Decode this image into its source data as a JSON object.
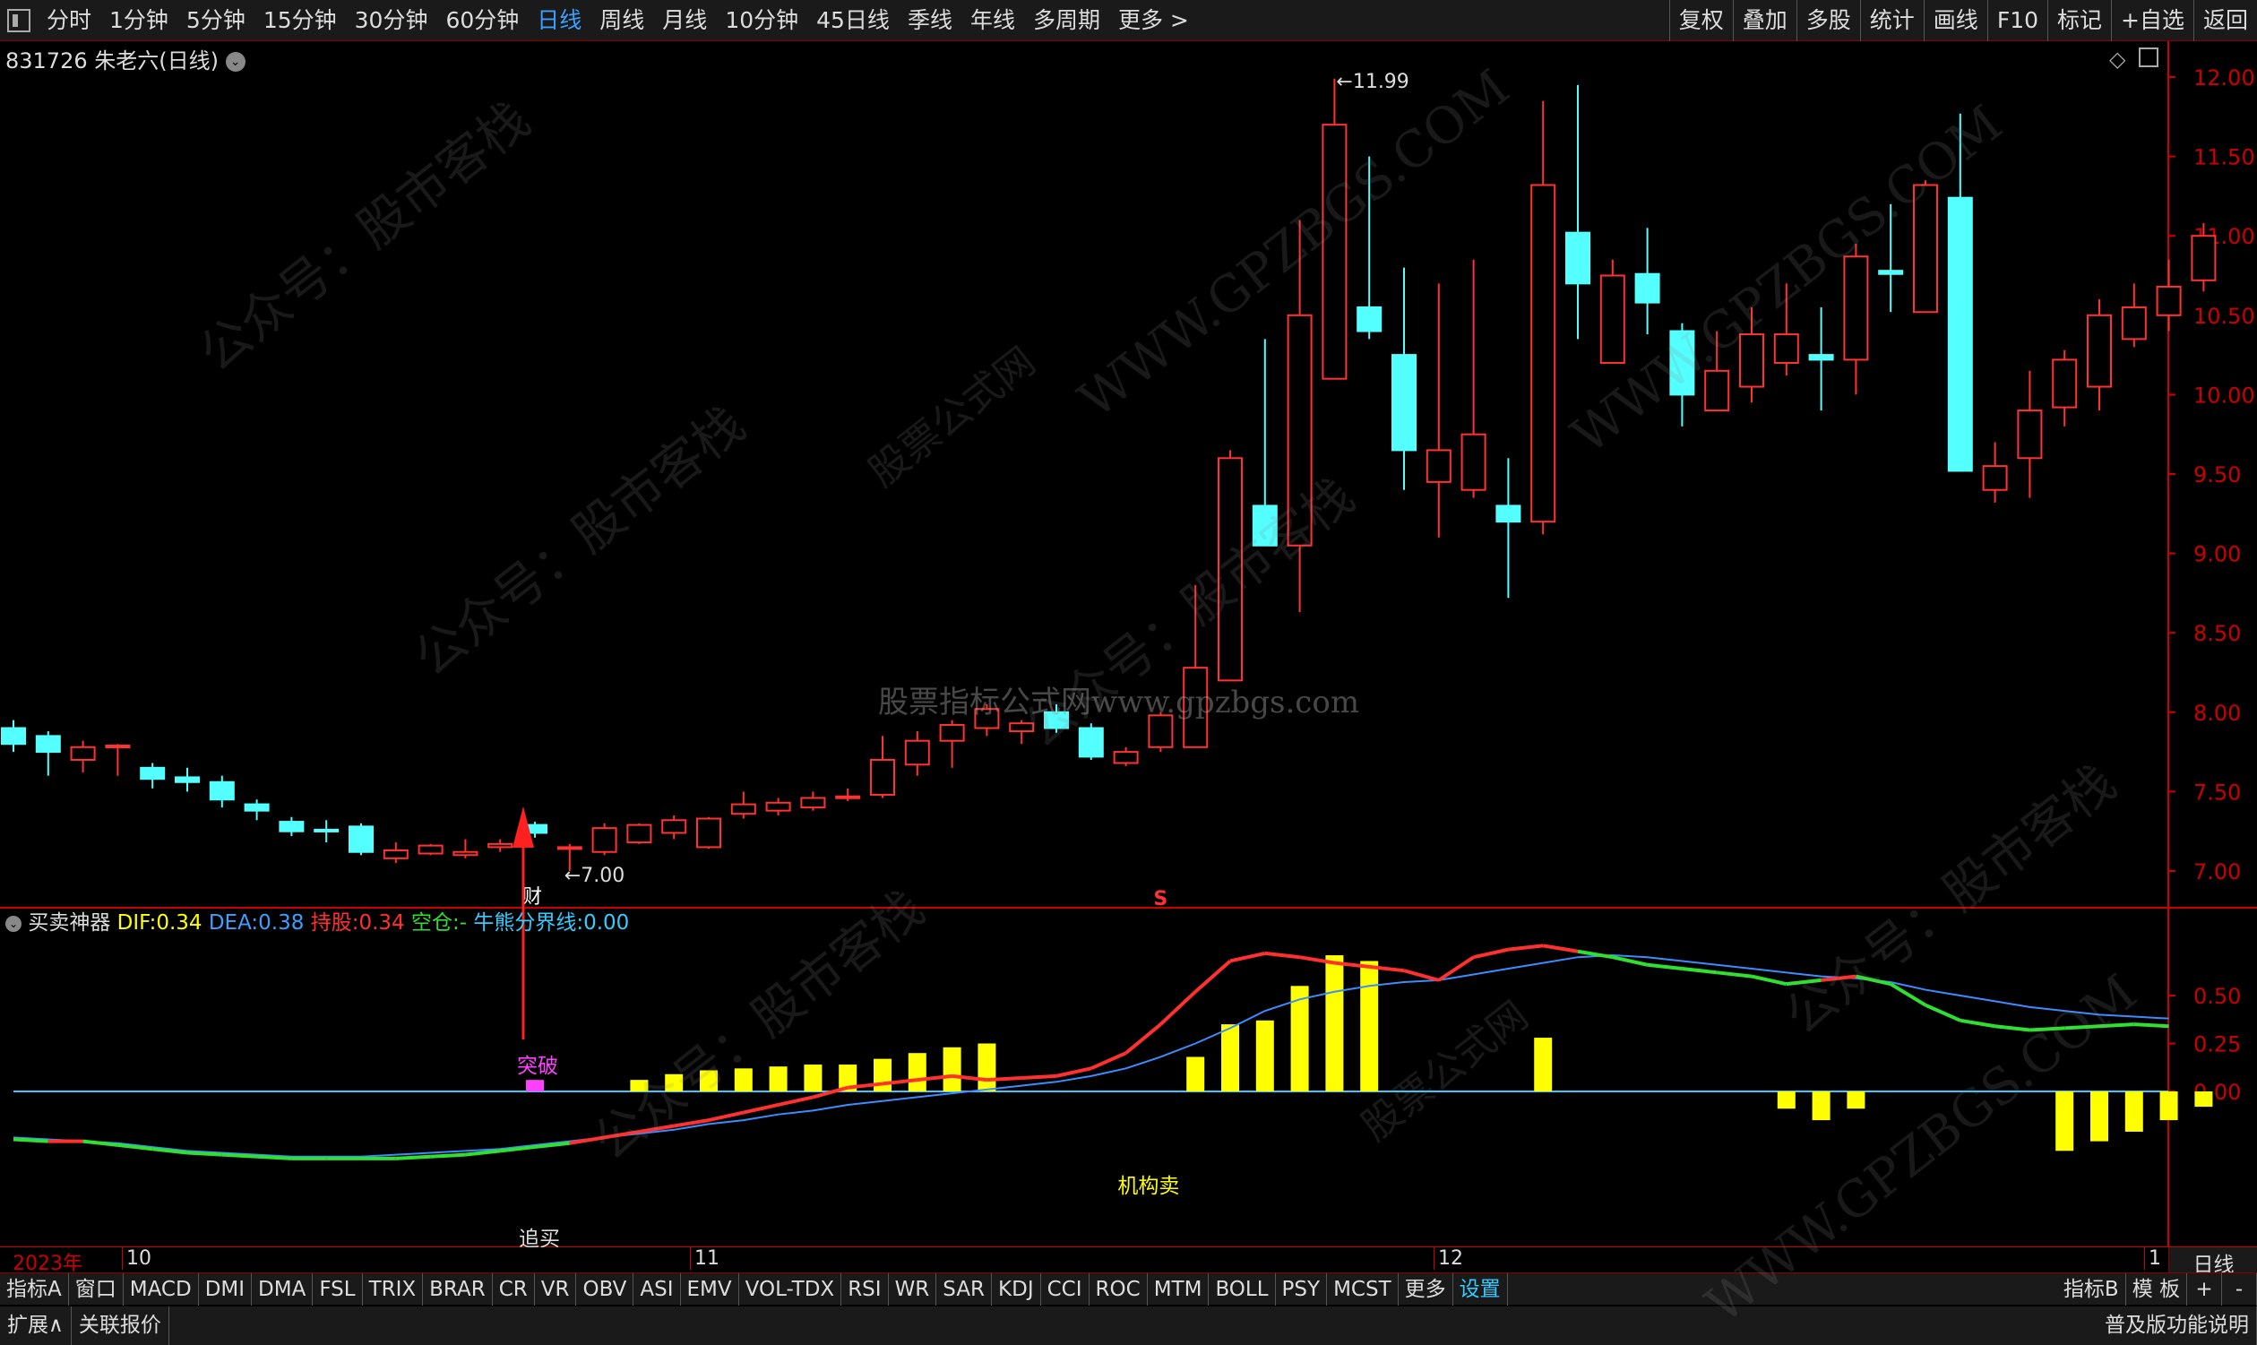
{
  "toolbar": {
    "periods": [
      "分时",
      "1分钟",
      "5分钟",
      "15分钟",
      "30分钟",
      "60分钟",
      "日线",
      "周线",
      "月线",
      "10分钟",
      "45日线",
      "季线",
      "年线",
      "多周期",
      "更多 >"
    ],
    "active": "日线",
    "right": [
      "复权",
      "叠加",
      "多股",
      "统计",
      "画线",
      "F10",
      "标记",
      "+自选",
      "返回"
    ]
  },
  "title": {
    "code_name": "831726 朱老六(日线)",
    "info_icon": "chevron-down"
  },
  "price_axis": [
    "12.00",
    "11.50",
    "11.00",
    "10.50",
    "10.00",
    "9.50",
    "9.00",
    "8.50",
    "8.00",
    "7.50",
    "7.00"
  ],
  "annotations": {
    "high": "11.99",
    "low": "7.00",
    "cai": "财",
    "s_marker": "S",
    "tupo": "突破",
    "jigoumai": "机构卖",
    "zhuimai": "追买"
  },
  "indicator": {
    "name": "买卖神器",
    "dif_label": "DIF:",
    "dif": "0.34",
    "dea_label": "DEA:",
    "dea": "0.38",
    "hold_label": "持股:",
    "hold": "0.34",
    "empty_label": "空仓:",
    "empty": "-",
    "bull_label": "牛熊分界线:",
    "bull": "0.00",
    "axis": [
      "0.50",
      "0.25",
      "0.00"
    ]
  },
  "dates": [
    "2023年",
    "10",
    "11",
    "12",
    "1"
  ],
  "date_right": "日线",
  "indicators": [
    "指标A",
    "窗口",
    "MACD",
    "DMI",
    "DMA",
    "FSL",
    "TRIX",
    "BRAR",
    "CR",
    "VR",
    "OBV",
    "ASI",
    "EMV",
    "VOL-TDX",
    "RSI",
    "WR",
    "SAR",
    "KDJ",
    "CCI",
    "ROC",
    "MTM",
    "BOLL",
    "PSY",
    "MCST",
    "更多",
    "设置"
  ],
  "indicators_right": [
    "指标B",
    "模 板",
    "+",
    "-"
  ],
  "bottom": [
    "扩展∧",
    "关联报价"
  ],
  "bottom_right": "普及版功能说明",
  "watermarks": [
    "公众号：股市客栈",
    "WWW.GPZBGS.COM",
    "股票公式网",
    "股票指标公式网www.gpzbgs.com"
  ],
  "chart_data": {
    "type": "candlestick",
    "ylim": [
      6.9,
      12.1
    ],
    "candles": [
      {
        "o": 7.9,
        "c": 7.8,
        "h": 7.95,
        "l": 7.75
      },
      {
        "o": 7.85,
        "c": 7.75,
        "h": 7.88,
        "l": 7.6
      },
      {
        "o": 7.7,
        "c": 7.78,
        "h": 7.82,
        "l": 7.62
      },
      {
        "o": 7.78,
        "c": 7.79,
        "h": 7.8,
        "l": 7.6
      },
      {
        "o": 7.65,
        "c": 7.58,
        "h": 7.68,
        "l": 7.52
      },
      {
        "o": 7.59,
        "c": 7.56,
        "h": 7.65,
        "l": 7.5
      },
      {
        "o": 7.56,
        "c": 7.45,
        "h": 7.6,
        "l": 7.4
      },
      {
        "o": 7.42,
        "c": 7.38,
        "h": 7.45,
        "l": 7.32
      },
      {
        "o": 7.31,
        "c": 7.25,
        "h": 7.34,
        "l": 7.22
      },
      {
        "o": 7.26,
        "c": 7.25,
        "h": 7.32,
        "l": 7.18
      },
      {
        "o": 7.28,
        "c": 7.12,
        "h": 7.3,
        "l": 7.1
      },
      {
        "o": 7.08,
        "c": 7.13,
        "h": 7.18,
        "l": 7.05
      },
      {
        "o": 7.11,
        "c": 7.16,
        "h": 7.17,
        "l": 7.1
      },
      {
        "o": 7.1,
        "c": 7.12,
        "h": 7.2,
        "l": 7.08
      },
      {
        "o": 7.15,
        "c": 7.17,
        "h": 7.2,
        "l": 7.12
      },
      {
        "o": 7.29,
        "c": 7.24,
        "h": 7.31,
        "l": 7.21
      },
      {
        "o": 7.14,
        "c": 7.15,
        "h": 7.17,
        "l": 7.0
      },
      {
        "o": 7.12,
        "c": 7.27,
        "h": 7.3,
        "l": 7.1
      },
      {
        "o": 7.18,
        "c": 7.29,
        "h": 7.3,
        "l": 7.17
      },
      {
        "o": 7.24,
        "c": 7.32,
        "h": 7.35,
        "l": 7.2
      },
      {
        "o": 7.15,
        "c": 7.33,
        "h": 7.34,
        "l": 7.14
      },
      {
        "o": 7.36,
        "c": 7.42,
        "h": 7.5,
        "l": 7.33
      },
      {
        "o": 7.38,
        "c": 7.43,
        "h": 7.46,
        "l": 7.35
      },
      {
        "o": 7.4,
        "c": 7.46,
        "h": 7.5,
        "l": 7.38
      },
      {
        "o": 7.46,
        "c": 7.47,
        "h": 7.52,
        "l": 7.44
      },
      {
        "o": 7.48,
        "c": 7.7,
        "h": 7.85,
        "l": 7.46
      },
      {
        "o": 7.67,
        "c": 7.82,
        "h": 7.88,
        "l": 7.6
      },
      {
        "o": 7.82,
        "c": 7.92,
        "h": 7.95,
        "l": 7.65
      },
      {
        "o": 7.9,
        "c": 8.02,
        "h": 8.05,
        "l": 7.85
      },
      {
        "o": 7.88,
        "c": 7.93,
        "h": 7.95,
        "l": 7.8
      },
      {
        "o": 8.0,
        "c": 7.9,
        "h": 8.05,
        "l": 7.87
      },
      {
        "o": 7.9,
        "c": 7.72,
        "h": 7.93,
        "l": 7.7
      },
      {
        "o": 7.68,
        "c": 7.75,
        "h": 7.78,
        "l": 7.66
      },
      {
        "o": 7.78,
        "c": 7.98,
        "h": 8.0,
        "l": 7.75
      },
      {
        "o": 7.78,
        "c": 8.28,
        "h": 8.8,
        "l": 7.78
      },
      {
        "o": 8.2,
        "c": 9.6,
        "h": 9.65,
        "l": 8.2
      },
      {
        "o": 9.3,
        "c": 9.05,
        "h": 10.35,
        "l": 9.05
      },
      {
        "o": 9.05,
        "c": 10.5,
        "h": 11.1,
        "l": 8.63
      },
      {
        "o": 10.1,
        "c": 11.7,
        "h": 11.99,
        "l": 10.1
      },
      {
        "o": 10.55,
        "c": 10.4,
        "h": 11.5,
        "l": 10.35
      },
      {
        "o": 10.25,
        "c": 9.65,
        "h": 10.8,
        "l": 9.4
      },
      {
        "o": 9.45,
        "c": 9.65,
        "h": 10.7,
        "l": 9.1
      },
      {
        "o": 9.4,
        "c": 9.75,
        "h": 10.85,
        "l": 9.35
      },
      {
        "o": 9.3,
        "c": 9.2,
        "h": 9.6,
        "l": 8.72
      },
      {
        "o": 9.2,
        "c": 11.32,
        "h": 11.85,
        "l": 9.12
      },
      {
        "o": 11.02,
        "c": 10.7,
        "h": 11.95,
        "l": 10.35
      },
      {
        "o": 10.2,
        "c": 10.75,
        "h": 10.85,
        "l": 10.2
      },
      {
        "o": 10.76,
        "c": 10.58,
        "h": 11.05,
        "l": 10.38
      },
      {
        "o": 10.4,
        "c": 10.0,
        "h": 10.45,
        "l": 9.8
      },
      {
        "o": 9.9,
        "c": 10.15,
        "h": 10.4,
        "l": 9.9
      },
      {
        "o": 10.05,
        "c": 10.38,
        "h": 10.55,
        "l": 9.95
      },
      {
        "o": 10.2,
        "c": 10.38,
        "h": 10.7,
        "l": 10.12
      },
      {
        "o": 10.25,
        "c": 10.22,
        "h": 10.55,
        "l": 9.9
      },
      {
        "o": 10.22,
        "c": 10.87,
        "h": 10.95,
        "l": 10.0
      },
      {
        "o": 10.78,
        "c": 10.76,
        "h": 11.2,
        "l": 10.52
      },
      {
        "o": 10.52,
        "c": 11.32,
        "h": 11.35,
        "l": 10.52
      },
      {
        "o": 11.24,
        "c": 9.52,
        "h": 11.77,
        "l": 9.52
      },
      {
        "o": 9.4,
        "c": 9.55,
        "h": 9.7,
        "l": 9.32
      },
      {
        "o": 9.6,
        "c": 9.9,
        "h": 10.15,
        "l": 9.35
      },
      {
        "o": 9.92,
        "c": 10.22,
        "h": 10.28,
        "l": 9.8
      },
      {
        "o": 10.05,
        "c": 10.5,
        "h": 10.6,
        "l": 9.9
      },
      {
        "o": 10.35,
        "c": 10.55,
        "h": 10.7,
        "l": 10.3
      },
      {
        "o": 10.5,
        "c": 10.68,
        "h": 10.85,
        "l": 10.4
      },
      {
        "o": 10.72,
        "c": 11.0,
        "h": 11.08,
        "l": 10.65
      }
    ],
    "indicator_bars": [
      {
        "i": 15,
        "v": 0.06,
        "color": "#ff40ff"
      },
      {
        "i": 18,
        "v": 0.06
      },
      {
        "i": 19,
        "v": 0.09
      },
      {
        "i": 20,
        "v": 0.11
      },
      {
        "i": 21,
        "v": 0.12
      },
      {
        "i": 22,
        "v": 0.13
      },
      {
        "i": 23,
        "v": 0.14
      },
      {
        "i": 24,
        "v": 0.14
      },
      {
        "i": 25,
        "v": 0.17
      },
      {
        "i": 26,
        "v": 0.2
      },
      {
        "i": 27,
        "v": 0.23
      },
      {
        "i": 28,
        "v": 0.25
      },
      {
        "i": 34,
        "v": 0.18
      },
      {
        "i": 35,
        "v": 0.35
      },
      {
        "i": 36,
        "v": 0.37
      },
      {
        "i": 37,
        "v": 0.55
      },
      {
        "i": 38,
        "v": 0.71
      },
      {
        "i": 39,
        "v": 0.68
      },
      {
        "i": 44,
        "v": 0.28
      },
      {
        "i": 51,
        "v": -0.09
      },
      {
        "i": 52,
        "v": -0.15
      },
      {
        "i": 53,
        "v": -0.09
      },
      {
        "i": 59,
        "v": -0.31
      },
      {
        "i": 60,
        "v": -0.26
      },
      {
        "i": 61,
        "v": -0.21
      },
      {
        "i": 62,
        "v": -0.15
      },
      {
        "i": 63,
        "v": -0.08
      }
    ],
    "dif_line": [
      -0.25,
      -0.26,
      -0.26,
      -0.28,
      -0.3,
      -0.32,
      -0.33,
      -0.34,
      -0.35,
      -0.35,
      -0.35,
      -0.35,
      -0.34,
      -0.33,
      -0.31,
      -0.29,
      -0.27,
      -0.24,
      -0.21,
      -0.18,
      -0.15,
      -0.11,
      -0.07,
      -0.03,
      0.02,
      0.04,
      0.06,
      0.08,
      0.06,
      0.07,
      0.08,
      0.12,
      0.2,
      0.35,
      0.52,
      0.68,
      0.72,
      0.7,
      0.67,
      0.65,
      0.63,
      0.58,
      0.7,
      0.74,
      0.76,
      0.73,
      0.7,
      0.66,
      0.64,
      0.62,
      0.6,
      0.56,
      0.58,
      0.6,
      0.56,
      0.45,
      0.37,
      0.34,
      0.32,
      0.33,
      0.34,
      0.35,
      0.34
    ],
    "dea_line": [
      -0.24,
      -0.25,
      -0.26,
      -0.27,
      -0.29,
      -0.31,
      -0.32,
      -0.33,
      -0.34,
      -0.34,
      -0.34,
      -0.33,
      -0.32,
      -0.31,
      -0.3,
      -0.28,
      -0.26,
      -0.24,
      -0.22,
      -0.2,
      -0.17,
      -0.15,
      -0.12,
      -0.1,
      -0.07,
      -0.05,
      -0.03,
      -0.01,
      0.01,
      0.03,
      0.05,
      0.08,
      0.12,
      0.18,
      0.25,
      0.33,
      0.42,
      0.48,
      0.52,
      0.55,
      0.57,
      0.58,
      0.61,
      0.64,
      0.67,
      0.7,
      0.71,
      0.7,
      0.68,
      0.66,
      0.64,
      0.62,
      0.6,
      0.59,
      0.57,
      0.53,
      0.5,
      0.47,
      0.44,
      0.42,
      0.4,
      0.39,
      0.38
    ]
  }
}
